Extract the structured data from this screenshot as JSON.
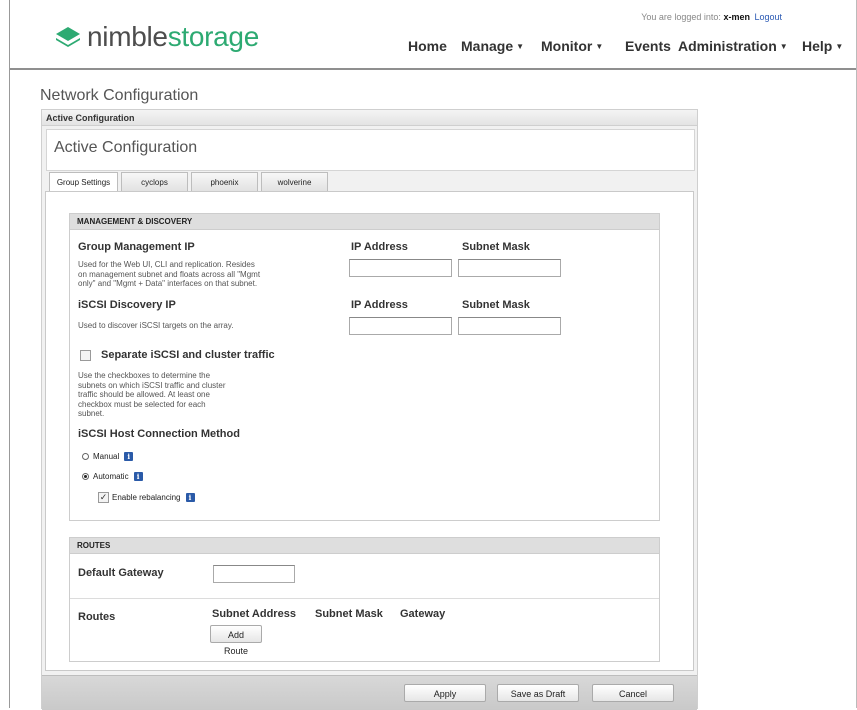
{
  "header": {
    "logo": {
      "nimble": "nimble",
      "storage": "storage"
    },
    "login": {
      "prefix": "You are logged into:",
      "user": "x-men",
      "logout": "Logout"
    },
    "nav": [
      {
        "label": "Home",
        "caret": ""
      },
      {
        "label": "Manage",
        "caret": "▼"
      },
      {
        "label": "Monitor",
        "caret": "▼"
      },
      {
        "label": "Events",
        "caret": ""
      },
      {
        "label": "Administration",
        "caret": "▼"
      },
      {
        "label": "Help",
        "caret": "▼"
      }
    ]
  },
  "page": {
    "title": "Network Configuration",
    "box_strip": "Active Configuration",
    "panel_title": "Active Configuration",
    "tabs": [
      "Group Settings",
      "cyclops",
      "phoenix",
      "wolverine"
    ],
    "active_tab": "Group Settings"
  },
  "mgmt": {
    "heading": "MANAGEMENT & DISCOVERY",
    "group_mgmt": {
      "label": "Group Management IP",
      "desc1": "Used for the Web UI, CLI and replication. Resides",
      "desc2": "on management subnet and floats across all \"Mgmt",
      "desc3": "only\" and \"Mgmt + Data\" interfaces on that subnet.",
      "ip_header": "IP Address",
      "mask_header": "Subnet Mask",
      "ip_value": "",
      "mask_value": ""
    },
    "iscsi_discovery": {
      "label": "iSCSI Discovery IP",
      "desc": "Used to discover iSCSI targets on the array.",
      "ip_header": "IP Address",
      "mask_header": "Subnet Mask",
      "ip_value": "",
      "mask_value": ""
    },
    "separate": {
      "label": "Separate iSCSI and cluster traffic",
      "checked": false,
      "desc1": "Use the checkboxes to determine the",
      "desc2": "subnets on which iSCSI traffic and cluster",
      "desc3": "traffic should be allowed. At least one",
      "desc4": "checkbox must be selected for each",
      "desc5": "subnet."
    },
    "host_conn": {
      "label": "iSCSI Host Connection Method",
      "manual": "Manual",
      "automatic": "Automatic",
      "selected": "Automatic",
      "rebalance": "Enable rebalancing",
      "rebalance_checked": true,
      "info": "i"
    }
  },
  "routes": {
    "heading": "ROUTES",
    "gateway_label": "Default Gateway",
    "gateway_value": "",
    "routes_label": "Routes",
    "columns": [
      "Subnet Address",
      "Subnet Mask",
      "Gateway"
    ],
    "add_route": "Add Route"
  },
  "footer": {
    "apply": "Apply",
    "save_draft": "Save as Draft",
    "cancel": "Cancel"
  },
  "colors": {
    "brand_green": "#2daa72",
    "logo_gray": "#4d4d4d",
    "info_blue": "#2a5aa8",
    "link_blue": "#2a59b3"
  }
}
